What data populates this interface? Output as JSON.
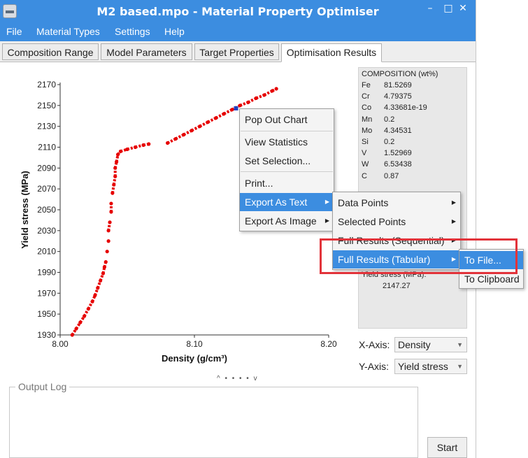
{
  "window": {
    "title": "M2 based.mpo - Material Property Optimiser",
    "controls": {
      "minimize": "–",
      "maximize": "□",
      "close": "✕"
    }
  },
  "menubar": {
    "items": [
      "File",
      "Material Types",
      "Settings",
      "Help"
    ]
  },
  "tabs": [
    "Composition Range",
    "Model Parameters",
    "Target Properties",
    "Optimisation Results"
  ],
  "active_tab": "Optimisation Results",
  "chart_data": {
    "type": "scatter",
    "xlabel": "Density (g/cm³)",
    "ylabel": "Yield stress (MPa)",
    "xlim": [
      8.0,
      8.2
    ],
    "ylim": [
      1930,
      2170
    ],
    "x_ticks": [
      "8.00",
      "8.10",
      "8.20"
    ],
    "y_ticks": [
      "1930",
      "1950",
      "1970",
      "1990",
      "2010",
      "2030",
      "2050",
      "2070",
      "2090",
      "2110",
      "2130",
      "2150",
      "2170"
    ],
    "series_color": "#e60000",
    "selected_point_color": "#1f3fbf",
    "selected_point": {
      "x": 8.131,
      "y": 2147.27
    },
    "points": [
      [
        8.009,
        1930
      ],
      [
        8.012,
        1936
      ],
      [
        8.015,
        1942
      ],
      [
        8.018,
        1948
      ],
      [
        8.021,
        1955
      ],
      [
        8.024,
        1962
      ],
      [
        8.026,
        1968
      ],
      [
        8.028,
        1975
      ],
      [
        8.03,
        1982
      ],
      [
        8.032,
        1989
      ],
      [
        8.033,
        1995
      ],
      [
        8.034,
        2000
      ],
      [
        8.035,
        2010
      ],
      [
        8.036,
        2020
      ],
      [
        8.036,
        2030
      ],
      [
        8.037,
        2038
      ],
      [
        8.038,
        2048
      ],
      [
        8.038,
        2056
      ],
      [
        8.039,
        2066
      ],
      [
        8.04,
        2074
      ],
      [
        8.041,
        2082
      ],
      [
        8.041,
        2090
      ],
      [
        8.042,
        2096
      ],
      [
        8.043,
        2103
      ],
      [
        8.045,
        2106
      ],
      [
        8.05,
        2108
      ],
      [
        8.056,
        2110
      ],
      [
        8.062,
        2112
      ],
      [
        8.066,
        2113
      ],
      [
        8.08,
        2114
      ],
      [
        8.086,
        2118
      ],
      [
        8.092,
        2122
      ],
      [
        8.098,
        2126
      ],
      [
        8.104,
        2130
      ],
      [
        8.11,
        2134
      ],
      [
        8.116,
        2138
      ],
      [
        8.122,
        2142
      ],
      [
        8.128,
        2146
      ],
      [
        8.134,
        2150
      ],
      [
        8.14,
        2153
      ],
      [
        8.146,
        2157
      ],
      [
        8.152,
        2160
      ],
      [
        8.158,
        2164
      ],
      [
        8.161,
        2166
      ]
    ]
  },
  "composition": {
    "heading": "COMPOSITION (wt%)",
    "rows": [
      {
        "el": "Fe",
        "val": "81.5269"
      },
      {
        "el": "Cr",
        "val": "4.79375"
      },
      {
        "el": "Co",
        "val": "4.33681e-19"
      },
      {
        "el": "Mn",
        "val": "0.2"
      },
      {
        "el": "Mo",
        "val": "4.34531"
      },
      {
        "el": "Si",
        "val": "0.2"
      },
      {
        "el": "V",
        "val": "1.52969"
      },
      {
        "el": "W",
        "val": "6.53438"
      },
      {
        "el": "C",
        "val": "0.87"
      }
    ],
    "yield_label": "Yield stress (MPa):",
    "yield_value": "2147.27"
  },
  "axis_controls": {
    "x_label": "X-Axis:",
    "x_value": "Density",
    "y_label": "Y-Axis:",
    "y_value": "Yield stress"
  },
  "output_log": {
    "label": "Output Log"
  },
  "start_button": "Start",
  "context_menu": {
    "items": [
      "Pop Out Chart",
      "View Statistics",
      "Set Selection...",
      "Print...",
      "Export As Text",
      "Export As Image"
    ]
  },
  "export_text_submenu": {
    "items": [
      "Data Points",
      "Selected Points",
      "Full Results (Sequential)",
      "Full Results (Tabular)"
    ]
  },
  "tabular_submenu": {
    "items": [
      "To File...",
      "To Clipboard"
    ]
  },
  "splitter": "^ • • • • v"
}
